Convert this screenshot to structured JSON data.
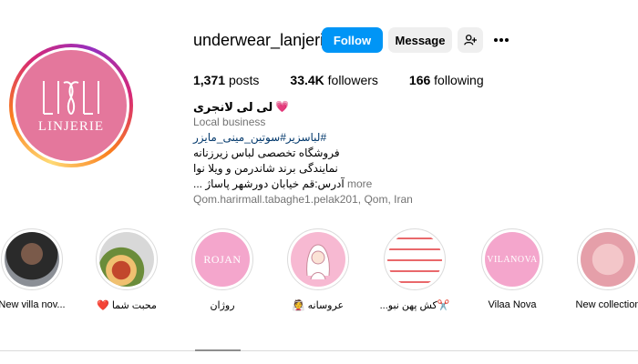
{
  "profile": {
    "username": "underwear_lanjeri",
    "follow_label": "Follow",
    "message_label": "Message",
    "suggest_icon": "person-plus-icon",
    "more_icon": "more-horizontal-icon",
    "avatar_text": "LINJERIE",
    "brand_color": "#e4779c"
  },
  "stats": {
    "posts_count": "1,371",
    "posts_label": "posts",
    "followers_count": "33.4K",
    "followers_label": "followers",
    "following_count": "166",
    "following_label": "following"
  },
  "bio": {
    "display_name": "لی لی لانجری",
    "heart_icon": "💗",
    "category": "Local business",
    "hashtags": "#لباسزیر#سوتین_مینی_مایزر",
    "line1": "فروشگاه تخصصی لباس زیرزنانه",
    "line2": "نمایندگی برند شاندرمن و ویلا نوا",
    "line3": "آدرس:قم خیابان دورشهر پاساژ ...",
    "more_label": "more",
    "address": "Qom.harirmall.tabaghe1.pelak201, Qom, Iran"
  },
  "highlights": [
    {
      "label": "New villa nov...",
      "image_text": ""
    },
    {
      "label": "محبت شما ❤️",
      "image_text": ""
    },
    {
      "label": "روژان",
      "image_text": "ROJAN"
    },
    {
      "label": "عروسانه 👰",
      "image_text": ""
    },
    {
      "label": "✂️کش پهن نبو...",
      "image_text": ""
    },
    {
      "label": "Vilaa Nova",
      "image_text": "VILANOVA"
    },
    {
      "label": "New collection",
      "image_text": ""
    }
  ],
  "colors": {
    "follow_button": "#0095f6",
    "secondary_button": "#efefef",
    "link": "#00376b",
    "muted": "#737373"
  }
}
